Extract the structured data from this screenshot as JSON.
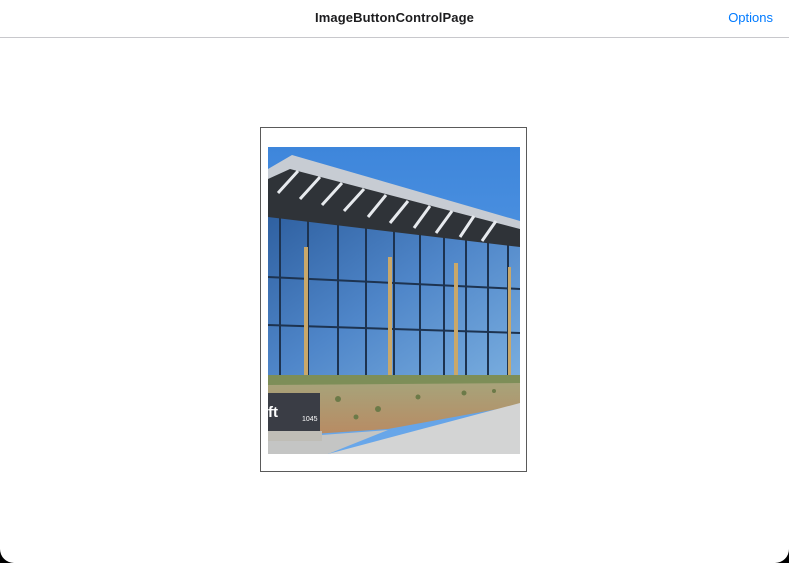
{
  "navbar": {
    "title": "ImageButtonControlPage",
    "options_label": "Options"
  },
  "image_button": {
    "image_description_icon": "building-photo",
    "sign_text": "ft",
    "sign_number": "1045"
  },
  "colors": {
    "accent": "#007aff",
    "sky": "#4a8fe0",
    "glass": "#3f78c4",
    "border": "#5a5a5a"
  }
}
